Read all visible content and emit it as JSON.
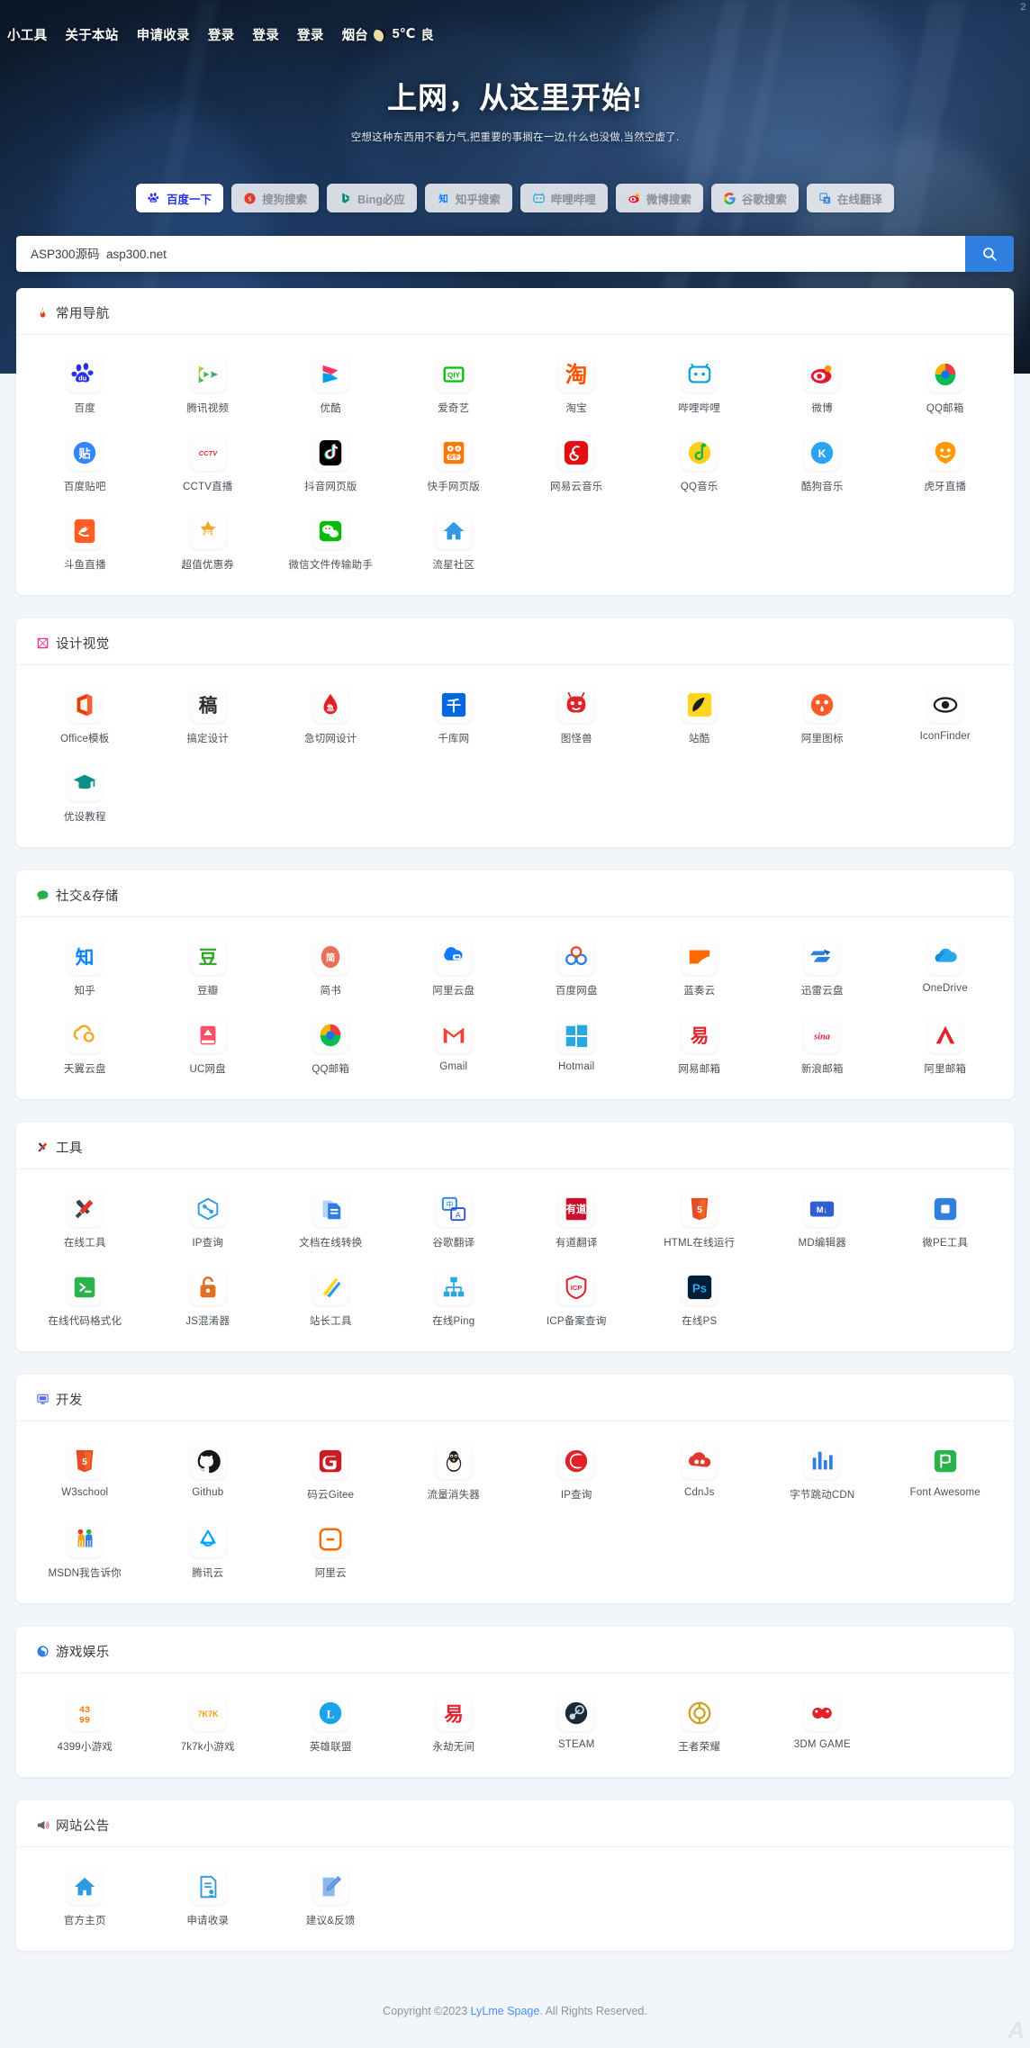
{
  "topnav": {
    "links": [
      "小工具",
      "关于本站",
      "申请收录",
      "登录",
      "登录",
      "登录"
    ],
    "city": "烟台",
    "temperature": "5℃",
    "air_quality": "良"
  },
  "corner": {
    "number": "2",
    "mark": "A"
  },
  "hero": {
    "title": "上网，从这里开始!",
    "subtitle": "空想这种东西用不着力气,把重要的事搁在一边,什么也没做,当然空虚了."
  },
  "search": {
    "placeholder": "ASP300源码  asp300.net",
    "value": "",
    "button_icon": "search-icon",
    "engines": [
      {
        "label": "百度一下",
        "icon": "baidu-icon",
        "active": true,
        "color": "#2932e1"
      },
      {
        "label": "搜狗搜索",
        "icon": "sogou-icon",
        "active": false,
        "color": "#e03a2f"
      },
      {
        "label": "Bing必应",
        "icon": "bing-icon",
        "active": false,
        "color": "#00897b"
      },
      {
        "label": "知乎搜索",
        "icon": "zhihu-icon",
        "active": false,
        "color": "#0084ff"
      },
      {
        "label": "哔哩哔哩",
        "icon": "bilibili-icon",
        "active": false,
        "color": "#00a1d6"
      },
      {
        "label": "微博搜索",
        "icon": "weibo-icon",
        "active": false,
        "color": "#e6162d"
      },
      {
        "label": "谷歌搜索",
        "icon": "google-icon",
        "active": false,
        "color": "#4285f4"
      },
      {
        "label": "在线翻译",
        "icon": "translate-icon",
        "active": false,
        "color": "#2f7fe0"
      }
    ]
  },
  "sections": [
    {
      "title": "常用导航",
      "icon": "fire-icon",
      "icon_color": "#e8412c",
      "items": [
        {
          "label": "百度",
          "icon": "baidu-icon"
        },
        {
          "label": "腾讯视频",
          "icon": "tencent-video-icon"
        },
        {
          "label": "优酷",
          "icon": "youku-icon"
        },
        {
          "label": "爱奇艺",
          "icon": "iqiyi-icon"
        },
        {
          "label": "淘宝",
          "icon": "taobao-icon"
        },
        {
          "label": "哔哩哔哩",
          "icon": "bilibili-icon"
        },
        {
          "label": "微博",
          "icon": "weibo-icon"
        },
        {
          "label": "QQ邮箱",
          "icon": "qqmail-icon"
        },
        {
          "label": "百度贴吧",
          "icon": "tieba-icon"
        },
        {
          "label": "CCTV直播",
          "icon": "cctv-icon"
        },
        {
          "label": "抖音网页版",
          "icon": "douyin-icon"
        },
        {
          "label": "快手网页版",
          "icon": "kuaishou-icon"
        },
        {
          "label": "网易云音乐",
          "icon": "netease-music-icon"
        },
        {
          "label": "QQ音乐",
          "icon": "qqmusic-icon"
        },
        {
          "label": "酷狗音乐",
          "icon": "kugou-icon"
        },
        {
          "label": "虎牙直播",
          "icon": "huya-icon"
        },
        {
          "label": "斗鱼直播",
          "icon": "douyu-icon"
        },
        {
          "label": "超值优惠券",
          "icon": "coupon-icon"
        },
        {
          "label": "微信文件传输助手",
          "icon": "wechat-icon"
        },
        {
          "label": "流星社区",
          "icon": "home-icon"
        }
      ]
    },
    {
      "title": "设计视觉",
      "icon": "design-icon",
      "icon_color": "#e0369a",
      "items": [
        {
          "label": "Office模板",
          "icon": "office-icon"
        },
        {
          "label": "搞定设计",
          "icon": "gaoding-icon"
        },
        {
          "label": "急切网设计",
          "icon": "jiqie-icon"
        },
        {
          "label": "千库网",
          "icon": "588ku-icon"
        },
        {
          "label": "图怪兽",
          "icon": "818ps-icon"
        },
        {
          "label": "站酷",
          "icon": "zcool-icon"
        },
        {
          "label": "阿里图标",
          "icon": "iconfont-icon"
        },
        {
          "label": "IconFinder",
          "icon": "iconfinder-icon"
        },
        {
          "label": "优设教程",
          "icon": "uisdc-icon"
        }
      ]
    },
    {
      "title": "社交&存储",
      "icon": "chat-icon",
      "icon_color": "#27b04b",
      "items": [
        {
          "label": "知乎",
          "icon": "zhihu-icon"
        },
        {
          "label": "豆瓣",
          "icon": "douban-icon"
        },
        {
          "label": "简书",
          "icon": "jianshu-icon"
        },
        {
          "label": "阿里云盘",
          "icon": "aliyunpan-icon"
        },
        {
          "label": "百度网盘",
          "icon": "baiduyun-icon"
        },
        {
          "label": "蓝奏云",
          "icon": "lanzou-icon"
        },
        {
          "label": "迅雷云盘",
          "icon": "xunlei-icon"
        },
        {
          "label": "OneDrive",
          "icon": "onedrive-icon"
        },
        {
          "label": "天翼云盘",
          "icon": "tianyi-icon"
        },
        {
          "label": "UC网盘",
          "icon": "uc-icon"
        },
        {
          "label": "QQ邮箱",
          "icon": "qqmail-icon"
        },
        {
          "label": "Gmail",
          "icon": "gmail-icon"
        },
        {
          "label": "Hotmail",
          "icon": "hotmail-icon"
        },
        {
          "label": "网易邮箱",
          "icon": "netease-mail-icon"
        },
        {
          "label": "新浪邮箱",
          "icon": "sina-mail-icon"
        },
        {
          "label": "阿里邮箱",
          "icon": "alimail-icon"
        }
      ]
    },
    {
      "title": "工具",
      "icon": "tools-icon",
      "icon_color": "#e05a2b",
      "items": [
        {
          "label": "在线工具",
          "icon": "tools-icon"
        },
        {
          "label": "IP查询",
          "icon": "ip-icon"
        },
        {
          "label": "文档在线转换",
          "icon": "doc-convert-icon"
        },
        {
          "label": "谷歌翻译",
          "icon": "google-translate-icon"
        },
        {
          "label": "有道翻译",
          "icon": "youdao-icon"
        },
        {
          "label": "HTML在线运行",
          "icon": "html5-icon"
        },
        {
          "label": "MD编辑器",
          "icon": "markdown-icon"
        },
        {
          "label": "微PE工具",
          "icon": "wepe-icon"
        },
        {
          "label": "在线代码格式化",
          "icon": "code-format-icon"
        },
        {
          "label": "JS混淆器",
          "icon": "lock-icon"
        },
        {
          "label": "站长工具",
          "icon": "chinaz-icon"
        },
        {
          "label": "在线Ping",
          "icon": "network-icon"
        },
        {
          "label": "ICP备案查询",
          "icon": "icp-icon"
        },
        {
          "label": "在线PS",
          "icon": "photoshop-icon"
        }
      ]
    },
    {
      "title": "开发",
      "icon": "monitor-icon",
      "icon_color": "#4a6fe0",
      "items": [
        {
          "label": "W3school",
          "icon": "html5-icon"
        },
        {
          "label": "Github",
          "icon": "github-icon"
        },
        {
          "label": "码云Gitee",
          "icon": "gitee-icon"
        },
        {
          "label": "流量消失器",
          "icon": "linux-icon"
        },
        {
          "label": "IP查询",
          "icon": "ip138-icon"
        },
        {
          "label": "CdnJs",
          "icon": "cdnjs-icon"
        },
        {
          "label": "字节跳动CDN",
          "icon": "bytedance-cdn-icon"
        },
        {
          "label": "Font Awesome",
          "icon": "font-awesome-icon"
        },
        {
          "label": "MSDN我告诉你",
          "icon": "msdn-icon"
        },
        {
          "label": "腾讯云",
          "icon": "tencent-cloud-icon"
        },
        {
          "label": "阿里云",
          "icon": "aliyun-icon"
        }
      ]
    },
    {
      "title": "游戏娱乐",
      "icon": "game-icon",
      "icon_color": "#2f7fe0",
      "items": [
        {
          "label": "4399小游戏",
          "icon": "4399-icon"
        },
        {
          "label": "7k7k小游戏",
          "icon": "7k7k-icon"
        },
        {
          "label": "英雄联盟",
          "icon": "lol-icon"
        },
        {
          "label": "永劫无间",
          "icon": "naraka-icon"
        },
        {
          "label": "STEAM",
          "icon": "steam-icon"
        },
        {
          "label": "王者荣耀",
          "icon": "wangzhe-icon"
        },
        {
          "label": "3DM GAME",
          "icon": "3dm-icon"
        }
      ]
    },
    {
      "title": "网站公告",
      "icon": "megaphone-icon",
      "icon_color": "#5a6struct",
      "items": [
        {
          "label": "官方主页",
          "icon": "home-icon"
        },
        {
          "label": "申请收录",
          "icon": "apply-icon"
        },
        {
          "label": "建议&反馈",
          "icon": "feedback-icon"
        }
      ]
    }
  ],
  "footer": {
    "prefix": "Copyright ©2023 ",
    "link": "LyLme Spage",
    "suffix": ". All Rights Reserved."
  }
}
